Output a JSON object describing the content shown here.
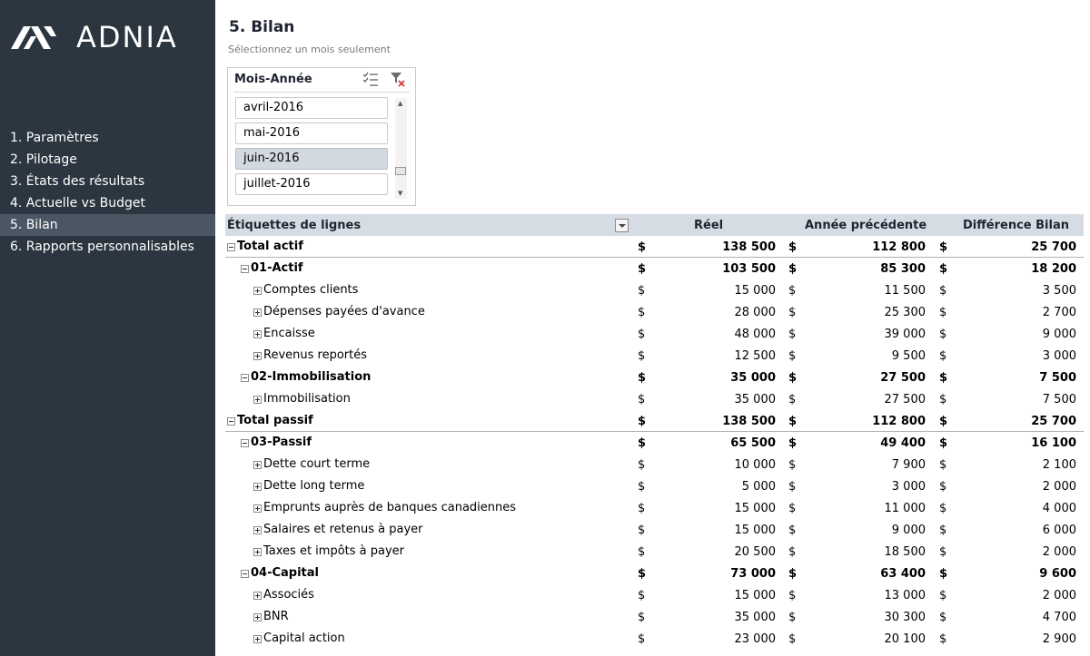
{
  "brand": {
    "name": "ADNIA"
  },
  "sidebar": {
    "items": [
      {
        "label": "1. Paramètres",
        "active": false
      },
      {
        "label": "2. Pilotage",
        "active": false
      },
      {
        "label": "3. États des résultats",
        "active": false
      },
      {
        "label": "4. Actuelle vs Budget",
        "active": false
      },
      {
        "label": "5. Bilan",
        "active": true
      },
      {
        "label": "6. Rapports personnalisables",
        "active": false
      }
    ]
  },
  "header": {
    "title": "5. Bilan",
    "subtitle": "Sélectionnez un mois seulement"
  },
  "slicer": {
    "title": "Mois-Année",
    "items": [
      {
        "label": "avril-2016",
        "selected": false
      },
      {
        "label": "mai-2016",
        "selected": false
      },
      {
        "label": "juin-2016",
        "selected": true
      },
      {
        "label": "juillet-2016",
        "selected": false
      }
    ]
  },
  "pivot": {
    "headers": {
      "label": "Étiquettes de lignes",
      "reel": "Réel",
      "previous": "Année précédente",
      "diff": "Différence Bilan"
    },
    "currency": "$",
    "rows": [
      {
        "label": "Total actif",
        "level": 0,
        "bold": true,
        "toggle": "minus",
        "total": true,
        "reel": "138 500",
        "prev": "112 800",
        "diff": "25 700"
      },
      {
        "label": "01-Actif",
        "level": 1,
        "bold": true,
        "toggle": "minus",
        "reel": "103 500",
        "prev": "85 300",
        "diff": "18 200"
      },
      {
        "label": "Comptes clients",
        "level": 2,
        "bold": false,
        "toggle": "plus",
        "reel": "15 000",
        "prev": "11 500",
        "diff": "3 500"
      },
      {
        "label": "Dépenses payées d'avance",
        "level": 2,
        "bold": false,
        "toggle": "plus",
        "reel": "28 000",
        "prev": "25 300",
        "diff": "2 700"
      },
      {
        "label": "Encaisse",
        "level": 2,
        "bold": false,
        "toggle": "plus",
        "reel": "48 000",
        "prev": "39 000",
        "diff": "9 000"
      },
      {
        "label": "Revenus reportés",
        "level": 2,
        "bold": false,
        "toggle": "plus",
        "reel": "12 500",
        "prev": "9 500",
        "diff": "3 000"
      },
      {
        "label": "02-Immobilisation",
        "level": 1,
        "bold": true,
        "toggle": "minus",
        "reel": "35 000",
        "prev": "27 500",
        "diff": "7 500"
      },
      {
        "label": "Immobilisation",
        "level": 2,
        "bold": false,
        "toggle": "plus",
        "reel": "35 000",
        "prev": "27 500",
        "diff": "7 500"
      },
      {
        "label": "Total passif",
        "level": 0,
        "bold": true,
        "toggle": "minus",
        "total": true,
        "reel": "138 500",
        "prev": "112 800",
        "diff": "25 700"
      },
      {
        "label": "03-Passif",
        "level": 1,
        "bold": true,
        "toggle": "minus",
        "reel": "65 500",
        "prev": "49 400",
        "diff": "16 100"
      },
      {
        "label": "Dette court terme",
        "level": 2,
        "bold": false,
        "toggle": "plus",
        "reel": "10 000",
        "prev": "7 900",
        "diff": "2 100"
      },
      {
        "label": "Dette long terme",
        "level": 2,
        "bold": false,
        "toggle": "plus",
        "reel": "5 000",
        "prev": "3 000",
        "diff": "2 000"
      },
      {
        "label": "Emprunts auprès de banques canadiennes",
        "level": 2,
        "bold": false,
        "toggle": "plus",
        "reel": "15 000",
        "prev": "11 000",
        "diff": "4 000"
      },
      {
        "label": "Salaires et retenus à payer",
        "level": 2,
        "bold": false,
        "toggle": "plus",
        "reel": "15 000",
        "prev": "9 000",
        "diff": "6 000"
      },
      {
        "label": "Taxes et impôts à payer",
        "level": 2,
        "bold": false,
        "toggle": "plus",
        "reel": "20 500",
        "prev": "18 500",
        "diff": "2 000"
      },
      {
        "label": "04-Capital",
        "level": 1,
        "bold": true,
        "toggle": "minus",
        "reel": "73 000",
        "prev": "63 400",
        "diff": "9 600"
      },
      {
        "label": "Associés",
        "level": 2,
        "bold": false,
        "toggle": "plus",
        "reel": "15 000",
        "prev": "13 000",
        "diff": "2 000"
      },
      {
        "label": "BNR",
        "level": 2,
        "bold": false,
        "toggle": "plus",
        "reel": "35 000",
        "prev": "30 300",
        "diff": "4 700"
      },
      {
        "label": "Capital action",
        "level": 2,
        "bold": false,
        "toggle": "plus",
        "reel": "23 000",
        "prev": "20 100",
        "diff": "2 900"
      }
    ]
  }
}
